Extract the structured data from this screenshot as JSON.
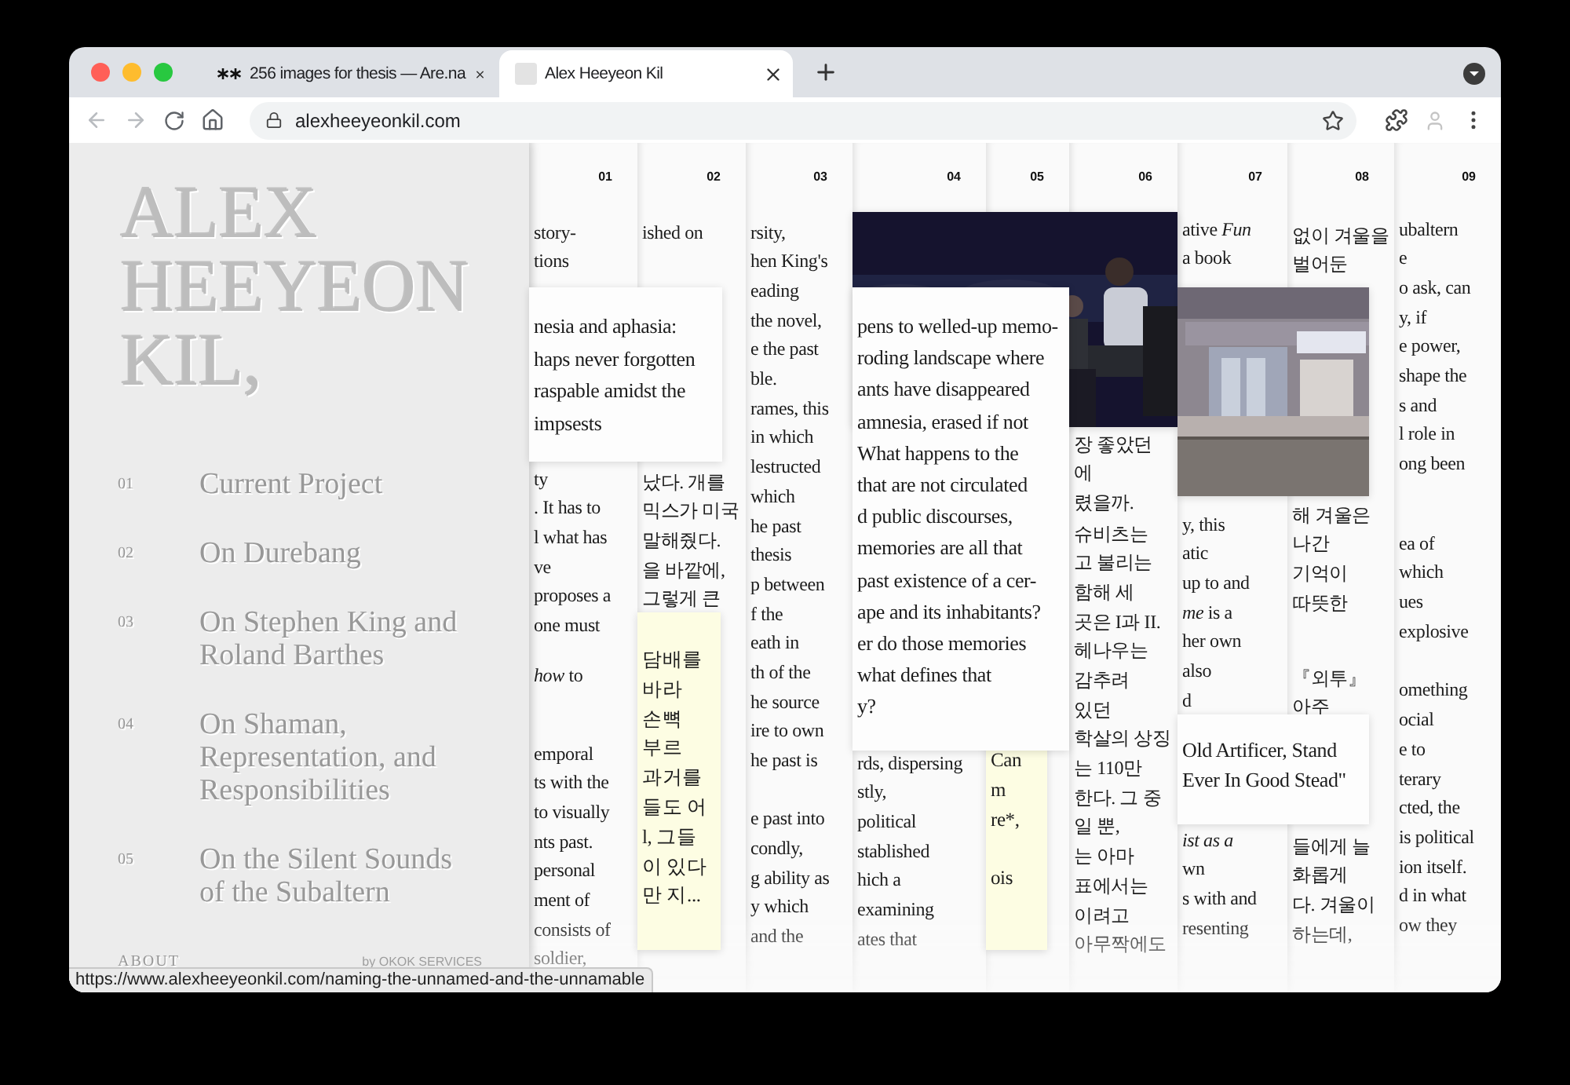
{
  "window": {
    "tabs": [
      {
        "title": "256 images for thesis — Are.na",
        "selected": false
      },
      {
        "title": "Alex Heeyeon Kil",
        "selected": true
      }
    ],
    "address": "alexheeyeonkil.com",
    "status_url": "https://www.alexheeyeonkil.com/naming-the-unnamed-and-the-unnamable"
  },
  "sidebar": {
    "title": "ALEX HEEYEON KIL,",
    "nav": [
      {
        "number": "01",
        "title": "Current Project"
      },
      {
        "number": "02",
        "title": "On Durebang"
      },
      {
        "number": "03",
        "title": "On Stephen King and Roland Barthes"
      },
      {
        "number": "04",
        "title": "On Shaman, Representation, and Responsibilities"
      },
      {
        "number": "05",
        "title": "On the Silent Sounds of the Subaltern"
      }
    ],
    "about": "ABOUT",
    "credit": "by OKOK SERVICES"
  },
  "columns": [
    {
      "number": "01",
      "paragraphs": [
        [
          "story-",
          "tions"
        ],
        [
          "ty",
          ". It has to",
          "l what has",
          "ve",
          "proposes a",
          "one must"
        ],
        [
          "*how* to"
        ],
        [
          "emporal",
          "ts with the",
          "to visually",
          "nts past.",
          "personal",
          "ment of",
          "consists of",
          "soldier,"
        ]
      ]
    },
    {
      "number": "02",
      "paragraphs": [
        [
          "ished on"
        ],
        [
          "났다. 개를",
          "믹스가 미국",
          "말해줬다.",
          "을 바깥에,",
          "그렇게 큰"
        ]
      ]
    },
    {
      "number": "03",
      "paragraphs": [
        [
          "rsity,",
          "hen King's",
          "eading",
          "the novel,",
          "e the past",
          "ble.",
          "rames, this",
          "in which",
          "lestructed",
          "which",
          "he past",
          "thesis",
          "p between",
          "f the",
          "eath in",
          "th of the",
          "he source",
          "ire to own",
          "he past is"
        ],
        [
          "e past into",
          "condly,",
          "g ability as",
          "y which",
          "and the"
        ]
      ]
    },
    {
      "number": "04",
      "paragraphs": [
        [
          "rds, dispersing",
          "stly,",
          "political",
          "stablished",
          "hich a",
          "examining",
          "ates that"
        ]
      ]
    },
    {
      "number": "05"
    },
    {
      "number": "06",
      "paragraphs": [
        [
          "장 좋았던",
          "에",
          "렸을까."
        ],
        [
          "슈비츠는",
          "고 불리는",
          "함해 세",
          "곳은 I과 II.",
          "헤나우는",
          "감추려",
          "있던",
          "학살의 상징",
          "는 110만",
          "한다. 그 중",
          "일 뿐,",
          "는 아마",
          "표에서는",
          "이려고",
          "아무짝에도"
        ]
      ]
    },
    {
      "number": "07",
      "paragraphs": [
        [
          "ative *Fun*",
          "a book"
        ],
        [
          "y, this",
          "atic",
          "up to and",
          "*me* is a",
          "her own",
          "also",
          "d"
        ],
        [
          "*ist as a*",
          "wn",
          "s with and",
          "resenting"
        ]
      ]
    },
    {
      "number": "08",
      "paragraphs": [
        [
          "없이 겨울을",
          "벌어둔"
        ],
        [
          "해 겨울은",
          "나간",
          "기억이",
          "따뜻한"
        ],
        [
          "『외투』",
          "아주"
        ],
        [
          "들에게 늘",
          "화롭게",
          "다. 겨울이",
          "하는데,"
        ]
      ]
    },
    {
      "number": "09",
      "paragraphs": [
        [
          "ubaltern",
          "e",
          "o ask, can",
          "y, if",
          "e power,",
          "shape the",
          "s and",
          "l role in",
          "ong been"
        ],
        [
          "ea of",
          "which",
          "ues",
          "explosive"
        ],
        [
          "omething",
          "ocial",
          "e to",
          "terary",
          "cted, the",
          "is political",
          "ion itself.",
          "d in what",
          "ow they"
        ]
      ]
    }
  ],
  "overlays": [
    {
      "kind": "picture"
    },
    {
      "kind": "card",
      "paragraphs": [
        [
          "pens to welled-up memo-",
          "roding landscape where",
          "ants have disappeared",
          "amnesia, erased if not",
          "What happens to the",
          "that are not circulated",
          "d public discourses,",
          "memories are all that",
          "past existence of a cer-",
          "ape and its inhabitants?",
          "er do those memories",
          "what defines that",
          "y?"
        ]
      ]
    },
    {
      "kind": "note",
      "paragraphs": [
        [
          "Can",
          "m",
          "re*,"
        ],
        [
          "ois"
        ]
      ]
    },
    {
      "kind": "picture"
    },
    {
      "kind": "card",
      "paragraphs": [
        [
          "nesia and aphasia:",
          "haps never forgotten",
          "raspable amidst the",
          "impsests"
        ]
      ]
    },
    {
      "kind": "note",
      "paragraphs": [
        [
          "담배를",
          "바라",
          "손뼉",
          "부르",
          "과거를",
          "들도 어",
          "l, 그들",
          "이 있다",
          "만 지..."
        ]
      ]
    },
    {
      "kind": "card",
      "paragraphs": [
        [
          "Old Artificer, Stand",
          "Ever In Good Stead\""
        ]
      ]
    }
  ]
}
